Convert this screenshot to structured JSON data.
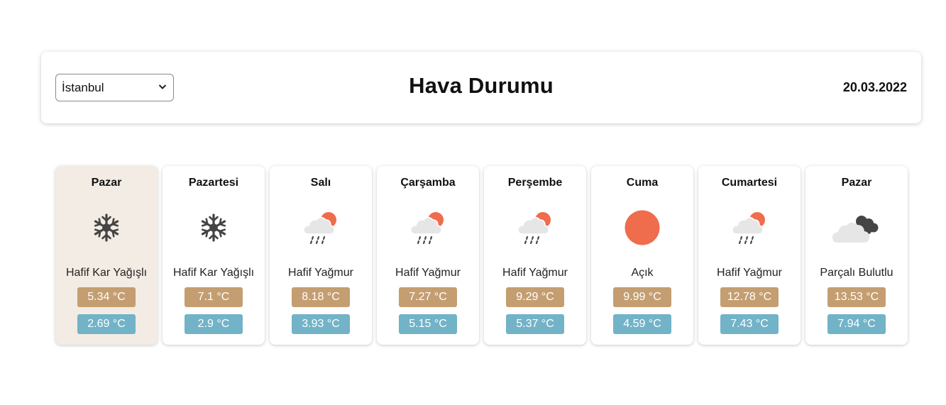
{
  "header": {
    "city_select": {
      "selected": "İstanbul"
    },
    "title": "Hava Durumu",
    "date": "20.03.2022"
  },
  "days": [
    {
      "day": "Pazar",
      "icon": "snow-icon",
      "desc": "Hafif Kar Yağışlı",
      "max": "5.34 °C",
      "min": "2.69 °C",
      "active": true
    },
    {
      "day": "Pazartesi",
      "icon": "snow-icon",
      "desc": "Hafif Kar Yağışlı",
      "max": "7.1 °C",
      "min": "2.9 °C",
      "active": false
    },
    {
      "day": "Salı",
      "icon": "light-rain-icon",
      "desc": "Hafif Yağmur",
      "max": "8.18 °C",
      "min": "3.93 °C",
      "active": false
    },
    {
      "day": "Çarşamba",
      "icon": "light-rain-icon",
      "desc": "Hafif Yağmur",
      "max": "7.27 °C",
      "min": "5.15 °C",
      "active": false
    },
    {
      "day": "Perşembe",
      "icon": "light-rain-icon",
      "desc": "Hafif Yağmur",
      "max": "9.29 °C",
      "min": "5.37 °C",
      "active": false
    },
    {
      "day": "Cuma",
      "icon": "clear-sun-icon",
      "desc": "Açık",
      "max": "9.99 °C",
      "min": "4.59 °C",
      "active": false
    },
    {
      "day": "Cumartesi",
      "icon": "light-rain-icon",
      "desc": "Hafif Yağmur",
      "max": "12.78 °C",
      "min": "7.43 °C",
      "active": false
    },
    {
      "day": "Pazar",
      "icon": "partly-cloudy-icon",
      "desc": "Parçalı Bulutlu",
      "max": "13.53 °C",
      "min": "7.94 °C",
      "active": false
    }
  ],
  "colors": {
    "max_badge": "#c49e71",
    "min_badge": "#72b3c7",
    "active_card": "#f3ece4",
    "sun": "#ef6c4d",
    "snow": "#444444",
    "cloud": "#e6e6e6"
  }
}
